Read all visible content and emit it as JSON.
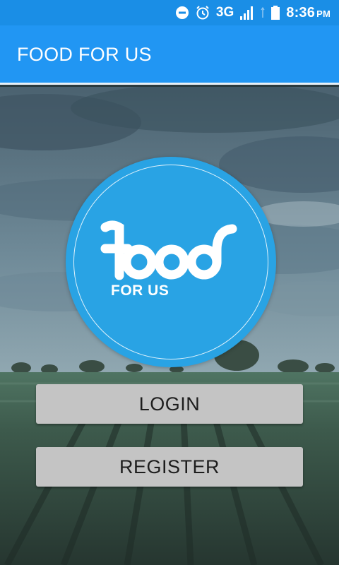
{
  "status_bar": {
    "network": "3G",
    "time": "8:36",
    "ampm": "PM",
    "icons": [
      "do-not-disturb-icon",
      "alarm-icon",
      "signal-icon",
      "battery-icon"
    ]
  },
  "app_bar": {
    "title": "FOOD FOR US"
  },
  "logo": {
    "wordmark": "food",
    "subtitle": "FOR US"
  },
  "buttons": {
    "login_label": "LOGIN",
    "register_label": "REGISTER"
  },
  "colors": {
    "status_bar": "#1a8ee6",
    "app_bar": "#2196f3",
    "logo_circle": "#29a3e4",
    "button_bg": "#c4c4c4"
  }
}
